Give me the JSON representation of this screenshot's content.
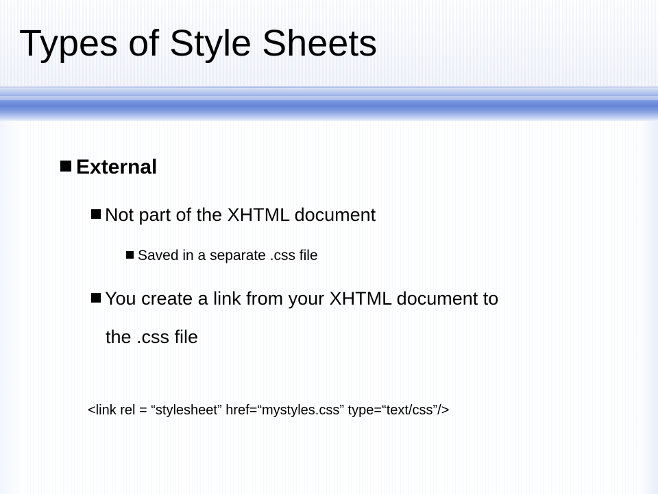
{
  "slide": {
    "title": "Types of Style Sheets",
    "bullets": {
      "level1": "External",
      "item1": "Not part of the XHTML document",
      "item1_sub": "Saved in a separate .css file",
      "item2_line1": "You create a link from your XHTML document to",
      "item2_line2": "the .css file"
    },
    "code_line": "<link rel = “stylesheet” href=“mystyles.css” type=“text/css”/>"
  },
  "colors": {
    "title_text": "#000000",
    "band_blue": "#6384d6",
    "bullet": "#000000"
  },
  "icons": {
    "bullet_marker": "square-bullet-icon"
  }
}
